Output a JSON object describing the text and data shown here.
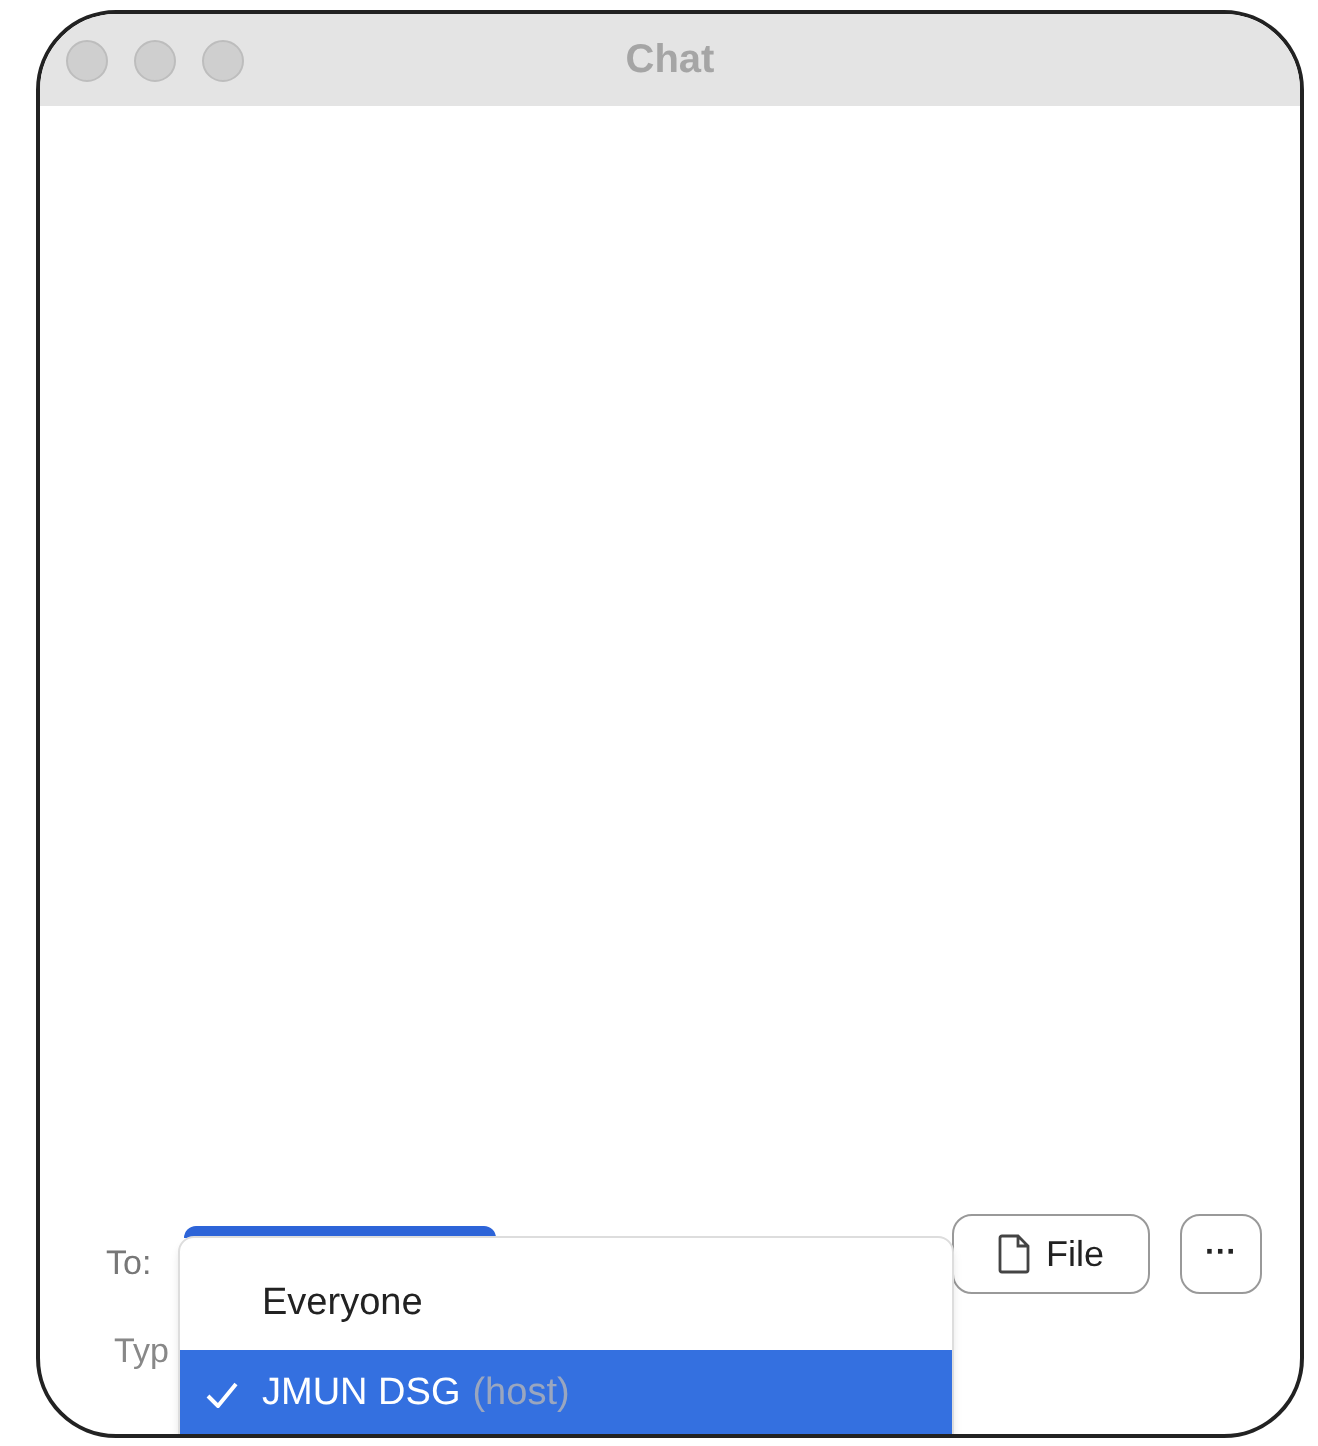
{
  "window": {
    "title": "Chat"
  },
  "to_label": "To:",
  "message_placeholder": "Typ",
  "buttons": {
    "file": "File",
    "more": "···"
  },
  "recipient_menu": [
    {
      "name": "Everyone",
      "selected": false
    },
    {
      "name": "JMUN DSG",
      "role": "(host)",
      "selected": true
    }
  ]
}
